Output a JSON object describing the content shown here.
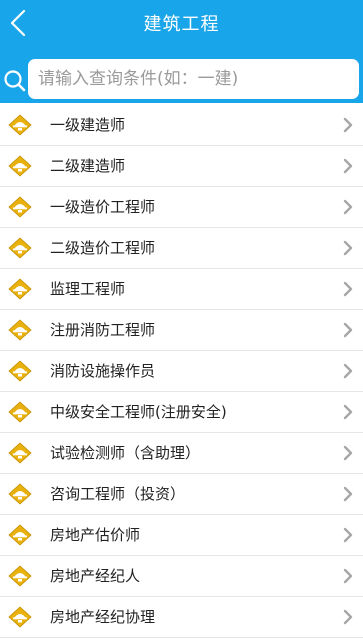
{
  "header": {
    "title": "建筑工程",
    "back_icon": "chevron-left-icon"
  },
  "search": {
    "placeholder": "请输入查询条件(如：一建)",
    "value": "",
    "icon": "search-icon"
  },
  "colors": {
    "header_bg": "#19a5ea",
    "item_icon": "#e8b10e",
    "chevron": "#a7a7a7",
    "divider": "#e6e6e6"
  },
  "list": {
    "item_icon": "diamond-hardhat-icon",
    "arrow_icon": "chevron-right-icon",
    "items": [
      {
        "label": "一级建造师"
      },
      {
        "label": "二级建造师"
      },
      {
        "label": "一级造价工程师"
      },
      {
        "label": "二级造价工程师"
      },
      {
        "label": "监理工程师"
      },
      {
        "label": "注册消防工程师"
      },
      {
        "label": "消防设施操作员"
      },
      {
        "label": "中级安全工程师(注册安全)"
      },
      {
        "label": "试验检测师（含助理）"
      },
      {
        "label": "咨询工程师（投资）"
      },
      {
        "label": "房地产估价师"
      },
      {
        "label": "房地产经纪人"
      },
      {
        "label": "房地产经纪协理"
      }
    ]
  }
}
